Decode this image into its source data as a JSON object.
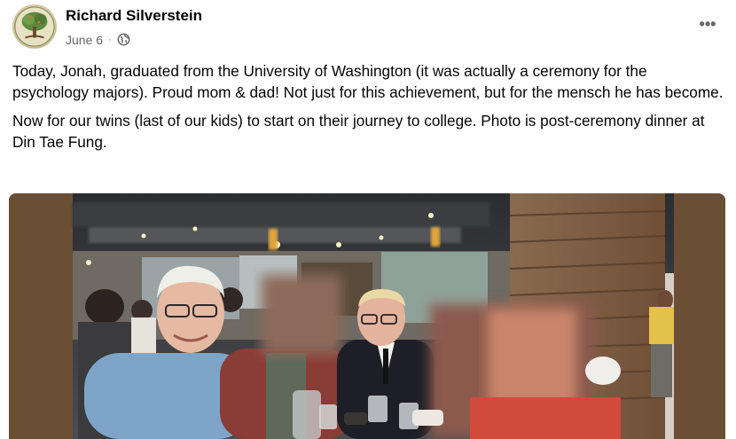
{
  "post": {
    "author": "Richard Silverstein",
    "date": "June 6",
    "separator": "·",
    "privacy_icon": "globe-icon",
    "more_icon": "more-options-icon",
    "more_label": "•••",
    "paragraphs": [
      "Today, Jonah, graduated from the University of Washington (it was actually a ceremony for the psychology majors).  Proud mom & dad!  Not just for this achievement, but for the mensch he has become.",
      "Now for our twins (last of our kids) to start on their journey to college. Photo is post-ceremony dinner at Din Tae Fung."
    ],
    "photo_icon": "restaurant-photo"
  },
  "colors": {
    "text_primary": "#050505",
    "text_secondary": "#65676b",
    "photo_frame": "#6b4f35"
  }
}
